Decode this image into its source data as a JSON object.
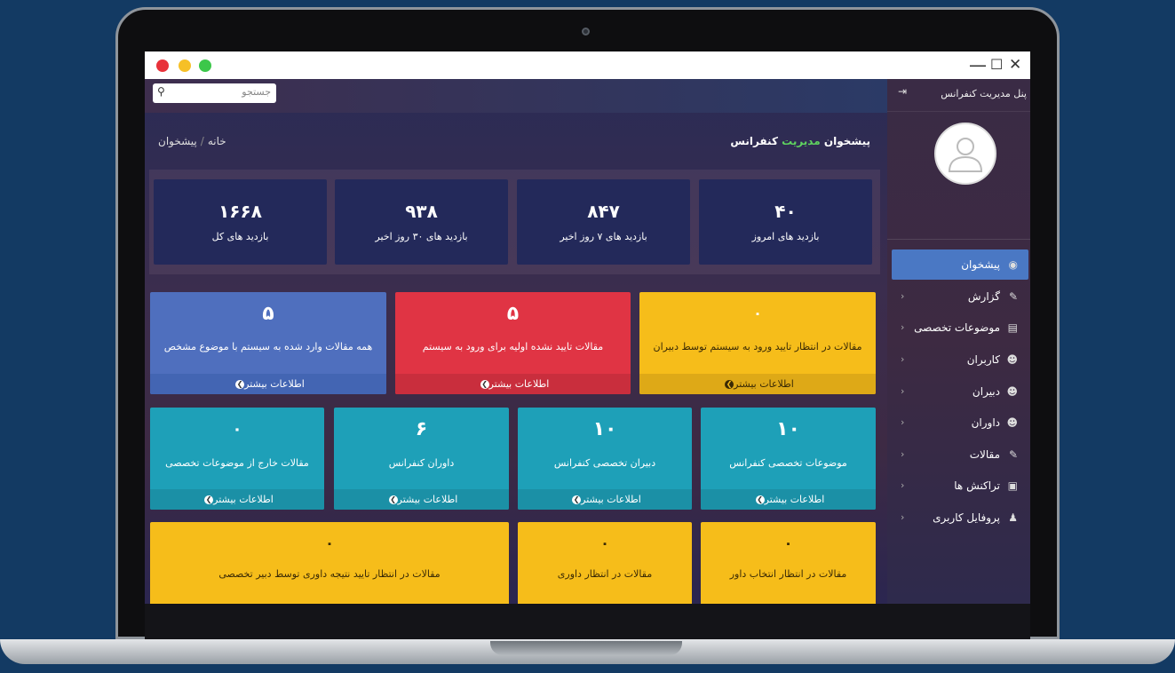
{
  "window": {
    "minimize": "—",
    "maximize": "☐",
    "close": "✕"
  },
  "search": {
    "placeholder": "جستجو"
  },
  "breadcrumb": {
    "home": "خانه",
    "sep": "/",
    "current": "پیشخوان"
  },
  "page_title": {
    "main": "پیشخوان",
    "accent": "مدیریت",
    "rest": "کنفرانس"
  },
  "stats": [
    {
      "value": "۴۰",
      "label": "بازدید های امروز"
    },
    {
      "value": "۸۴۷",
      "label": "بازدید های ۷ روز اخیر"
    },
    {
      "value": "۹۳۸",
      "label": "بازدید های ۳۰ روز اخیر"
    },
    {
      "value": "۱۶۶۸",
      "label": "بازدید های کل"
    }
  ],
  "row1": [
    {
      "value": "۵",
      "label": "همه مقالات وارد شده به سیستم با موضوع مشخص",
      "more": "اطلاعات بیشتر",
      "color": "#4f6fbe",
      "footer": "#4365b3"
    },
    {
      "value": "۵",
      "label": "مقالات تایید نشده اولیه برای ورود به سیستم",
      "more": "اطلاعات بیشتر",
      "color": "#e03444",
      "footer": "#c92e3d"
    },
    {
      "value": "۰",
      "label": "مقالات در انتظار تایید ورود به سیستم توسط دبیران",
      "more": "اطلاعات بیشتر",
      "color": "#f6bd1a",
      "footer": "#dea917"
    }
  ],
  "row2": [
    {
      "value": "۰",
      "label": "مقالات خارج از موضوعات تخصصی",
      "more": "اطلاعات بیشتر"
    },
    {
      "value": "۶",
      "label": "داوران کنفرانس",
      "more": "اطلاعات بیشتر"
    },
    {
      "value": "۱۰",
      "label": "دبیران تخصصی کنفرانس",
      "more": "اطلاعات بیشتر"
    },
    {
      "value": "۱۰",
      "label": "موضوعات تخصصی کنفرانس",
      "more": "اطلاعات بیشتر"
    }
  ],
  "row3": [
    {
      "value": "۰",
      "label": "مقالات در انتظار تایید نتیجه داوری توسط دبیر تخصصی"
    },
    {
      "value": "۰",
      "label": "مقالات در انتظار داوری"
    },
    {
      "value": "۰",
      "label": "مقالات در انتظار انتخاب داور"
    }
  ],
  "sidebar": {
    "title": "پنل مدیریت کنفرانس",
    "items": [
      {
        "label": "پیشخوان",
        "icon": "dashboard-icon",
        "glyph": "◉",
        "active": true
      },
      {
        "label": "گزارش",
        "icon": "edit-icon",
        "glyph": "✎"
      },
      {
        "label": "موضوعات تخصصی",
        "icon": "archive-icon",
        "glyph": "▤"
      },
      {
        "label": "کاربران",
        "icon": "users-icon",
        "glyph": "☻"
      },
      {
        "label": "دبیران",
        "icon": "users-icon",
        "glyph": "☻"
      },
      {
        "label": "داوران",
        "icon": "users-icon",
        "glyph": "☻"
      },
      {
        "label": "مقالات",
        "icon": "edit-icon",
        "glyph": "✎"
      },
      {
        "label": "تراکنش ها",
        "icon": "money-icon",
        "glyph": "▣"
      },
      {
        "label": "پروفایل کاربری",
        "icon": "user-icon",
        "glyph": "♟"
      }
    ]
  },
  "colors": {
    "teal": "#1ea0b8",
    "teal_footer": "#1b90a6",
    "yellow": "#f6bd1a",
    "active": "#4a78c4"
  }
}
